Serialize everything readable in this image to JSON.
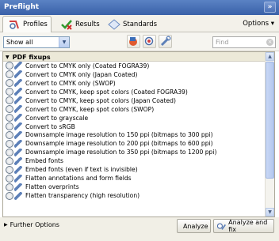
{
  "title": "Preflight",
  "title_close": "»",
  "tabs": [
    {
      "label": "Profiles",
      "icon": "profiles-icon"
    },
    {
      "label": "Results",
      "icon": "results-icon"
    },
    {
      "label": "Standards",
      "icon": "standards-icon"
    }
  ],
  "options_label": "Options ▾",
  "filter": {
    "select_value": "Show all",
    "find_placeholder": "Find"
  },
  "group": {
    "label": "PDF fixups",
    "items": [
      "Convert to CMYK only (Coated FOGRA39)",
      "Convert to CMYK only (Japan Coated)",
      "Convert to CMYK only (SWOP)",
      "Convert to CMYK, keep spot colors (Coated FOGRA39)",
      "Convert to CMYK, keep spot colors (Japan Coated)",
      "Convert to CMYK, keep spot colors (SWOP)",
      "Convert to grayscale",
      "Convert to sRGB",
      "Downsample image resolution to 150 ppi (bitmaps to 300 ppi)",
      "Downsample image resolution to 200 ppi (bitmaps to 600 ppi)",
      "Downsample image resolution to 350 ppi (bitmaps to 1200 ppi)",
      "Embed fonts",
      "Embed fonts (even if text is invisible)",
      "Flatten annotations and form fields",
      "Flatten overprints",
      "Flatten transparency (high resolution)"
    ]
  },
  "bottom": {
    "further_options": "Further Options",
    "analyze": "Analyze",
    "analyze_and_fix": "Analyze and fix"
  },
  "colors": {
    "titlebar": "#3a61a8",
    "accent": "#5d80b8"
  }
}
